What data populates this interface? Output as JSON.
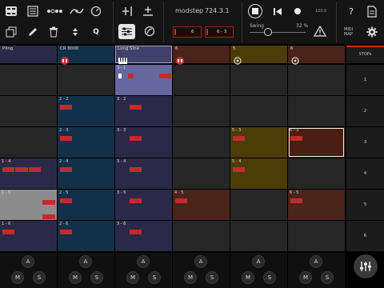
{
  "toolbar": {
    "app_name": "modstep",
    "version": "724.3.1",
    "tempo": "120.0",
    "swing_label": "Swing",
    "swing_value": "32 %",
    "midi_map_label": "MIDI MAP",
    "quantize_label": "Q",
    "box1": "6",
    "box2": "6 - 3",
    "icons": {
      "grid_view": "grid-icon",
      "list": "list-icon",
      "steps": "dots-icon",
      "automation": "wave-icon",
      "metronome": "metronome-icon",
      "add_track": "add-track-icon",
      "add_scene": "add-scene-icon",
      "duplicate": "duplicate-icon",
      "pencil": "pencil-icon",
      "trash": "trash-icon",
      "arrows": "updown-icon",
      "mixer_mode": "mixer-mode-icon",
      "swing_mode": "swing-icon",
      "stop": "stop-icon",
      "rewind": "rewind-icon",
      "record": "record-icon",
      "warning": "warning-icon",
      "help": "help-icon",
      "file": "file-icon",
      "settings": "gear-icon"
    }
  },
  "tracks": [
    {
      "name": "Pling",
      "color": "#2a2a48",
      "icon": "mute-dot-icon"
    },
    {
      "name": "CR 8000",
      "color": "#123048",
      "icon": "drum-icon"
    },
    {
      "name": "Long Sine",
      "color": "#40406c",
      "icon": "synth-icon"
    },
    {
      "name": "6",
      "color": "#4a2418",
      "icon": "drum-icon"
    },
    {
      "name": "5",
      "color": "#4c3c08",
      "icon": "instrument-icon"
    },
    {
      "name": "6",
      "color": "#4a2418",
      "icon": "instrument-icon"
    }
  ],
  "stops_label": "STOPs",
  "scenes": [
    "1",
    "2",
    "3",
    "4",
    "5",
    "6"
  ],
  "grid": [
    [
      {
        "bg": "#262626"
      },
      {
        "bg": "#262626"
      },
      {
        "label": "3 - 1",
        "bg": "#6868a0",
        "clips": [
          [
            0.06,
            0.05
          ],
          [
            0.23,
            0.1
          ],
          [
            0.77,
            0.22
          ]
        ],
        "clip_colors": [
          "#ffffff",
          "#c42a2a",
          "#c42a2a"
        ]
      },
      {
        "bg": "#262626"
      },
      {
        "bg": "#262626"
      },
      {
        "bg": "#262626"
      }
    ],
    [
      {
        "bg": "#262626"
      },
      {
        "label": "2 - 2",
        "bg": "#123048",
        "clips": [
          [
            0.04,
            0.22
          ]
        ]
      },
      {
        "label": "3 - 2",
        "bg": "#2a2a48",
        "clips": [
          [
            0.25,
            0.22
          ]
        ]
      },
      {
        "bg": "#262626"
      },
      {
        "bg": "#262626"
      },
      {
        "bg": "#262626"
      }
    ],
    [
      {
        "bg": "#262626"
      },
      {
        "label": "2 - 3",
        "bg": "#123048",
        "clips": [
          [
            0.04,
            0.22
          ]
        ]
      },
      {
        "label": "3 - 3",
        "bg": "#2a2a48",
        "clips": [
          [
            0.25,
            0.22
          ]
        ]
      },
      {
        "bg": "#262626"
      },
      {
        "label": "5 - 3",
        "bg": "#4c3c08",
        "clips": [
          [
            0.04,
            0.22
          ]
        ]
      },
      {
        "label": "6 - 3",
        "bg": "#4a1e10",
        "clips": [
          [
            0.04,
            0.22
          ]
        ],
        "selected": true
      }
    ],
    [
      {
        "label": "1 - 4",
        "bg": "#2a2a48",
        "clips": [
          [
            0.04,
            0.22
          ],
          [
            0.27,
            0.22
          ],
          [
            0.5,
            0.22
          ]
        ]
      },
      {
        "label": "2 - 4",
        "bg": "#123048",
        "clips": [
          [
            0.04,
            0.22
          ]
        ]
      },
      {
        "label": "3 - 4",
        "bg": "#2a2a48",
        "clips": [
          [
            0.25,
            0.22
          ]
        ]
      },
      {
        "bg": "#262626"
      },
      {
        "label": "5 - 4",
        "bg": "#4c3c08",
        "clips": [
          [
            0.04,
            0.22
          ]
        ]
      },
      {
        "bg": "#262626"
      }
    ],
    [
      {
        "label": "1 - 5",
        "bg": "#8c8c8c",
        "clips": [
          [
            0.75,
            0.22
          ],
          [
            0.75,
            0.22
          ]
        ],
        "clip_rows": [
          0.35,
          0.82
        ]
      },
      {
        "label": "2 - 5",
        "bg": "#123048",
        "clips": [
          [
            0.04,
            0.22
          ]
        ]
      },
      {
        "label": "3 - 5",
        "bg": "#2a2a48",
        "clips": [
          [
            0.25,
            0.22
          ]
        ]
      },
      {
        "label": "4 - 5",
        "bg": "#4a2418",
        "clips": [
          [
            0.04,
            0.22
          ]
        ]
      },
      {
        "bg": "#262626"
      },
      {
        "label": "6 - 5",
        "bg": "#4a2418",
        "clips": [
          [
            0.04,
            0.22
          ]
        ]
      }
    ],
    [
      {
        "label": "1 - 6",
        "bg": "#2a2a48",
        "clips": [
          [
            0.04,
            0.22
          ]
        ]
      },
      {
        "label": "2 - 6",
        "bg": "#123048",
        "clips": [
          [
            0.04,
            0.22
          ]
        ]
      },
      {
        "label": "3 - 6",
        "bg": "#2a2a48",
        "clips": [
          [
            0.25,
            0.22
          ]
        ]
      },
      {
        "bg": "#262626"
      },
      {
        "bg": "#262626"
      },
      {
        "bg": "#262626"
      }
    ]
  ],
  "bottom": {
    "arm_label": "A",
    "mute_label": "M",
    "solo_label": "S",
    "mixer_icon": "mixer-sliders-icon"
  }
}
